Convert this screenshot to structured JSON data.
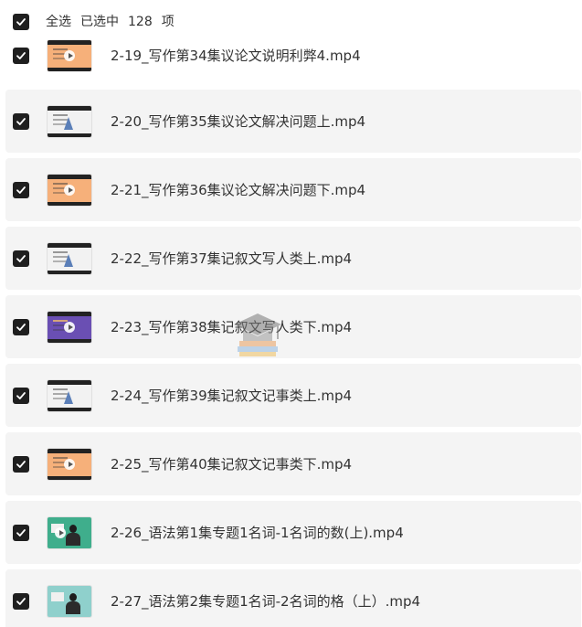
{
  "select_bar": {
    "select_all": "全选",
    "selected_prefix": "已选中",
    "selected_count": "128",
    "selected_suffix": "项"
  },
  "colors": {
    "row_background": "#f4f4f4",
    "checkbox": "#1f1f1f",
    "text": "#333333"
  },
  "files": [
    {
      "name": "2-19_写作第34集议论文说明利弊4.mp4",
      "thumbnail_style": "orange-slide",
      "checked": true
    },
    {
      "name": "2-20_写作第35集议论文解决问题上.mp4",
      "thumbnail_style": "white-slide",
      "checked": true
    },
    {
      "name": "2-21_写作第36集议论文解决问题下.mp4",
      "thumbnail_style": "orange-slide",
      "checked": true
    },
    {
      "name": "2-22_写作第37集记叙文写人类上.mp4",
      "thumbnail_style": "white-slide",
      "checked": true
    },
    {
      "name": "2-23_写作第38集记叙文写人类下.mp4",
      "thumbnail_style": "purple-slide",
      "checked": true
    },
    {
      "name": "2-24_写作第39集记叙文记事类上.mp4",
      "thumbnail_style": "white-slide",
      "checked": true
    },
    {
      "name": "2-25_写作第40集记叙文记事类下.mp4",
      "thumbnail_style": "orange-slide",
      "checked": true
    },
    {
      "name": "2-26_语法第1集专题1名词-1名词的数(上).mp4",
      "thumbnail_style": "teacher-green",
      "checked": true
    },
    {
      "name": "2-27_语法第2集专题1名词-2名词的格（上）.mp4",
      "thumbnail_style": "teacher-teal",
      "checked": true
    }
  ],
  "icons": {
    "checkbox": "check-icon",
    "play": "play-icon",
    "watermark_logo": "graduation-cap-icon"
  }
}
